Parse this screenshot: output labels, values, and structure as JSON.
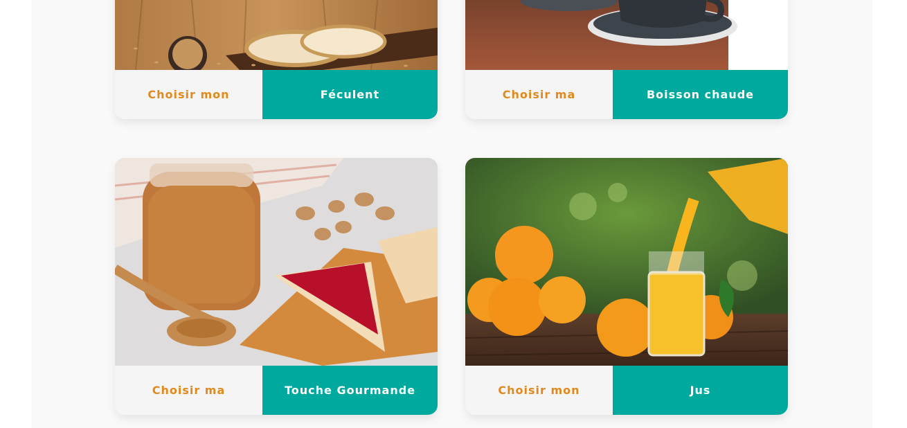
{
  "cards": [
    {
      "choose_label": "Choisir mon",
      "category_label": "Féculent",
      "image": "bread-and-wheat-photo"
    },
    {
      "choose_label": "Choisir ma",
      "category_label": "Boisson chaude",
      "image": "coffee-cup-photo"
    },
    {
      "choose_label": "Choisir ma",
      "category_label": "Touche Gourmande",
      "image": "peanut-butter-jam-toast-photo"
    },
    {
      "choose_label": "Choisir mon",
      "category_label": "Jus",
      "image": "orange-juice-photo"
    }
  ],
  "colors": {
    "accent": "#00a99d",
    "choose_text": "#e08a1e",
    "card_bg": "#f5f5f5",
    "page_bg": "#f9f9f9"
  }
}
